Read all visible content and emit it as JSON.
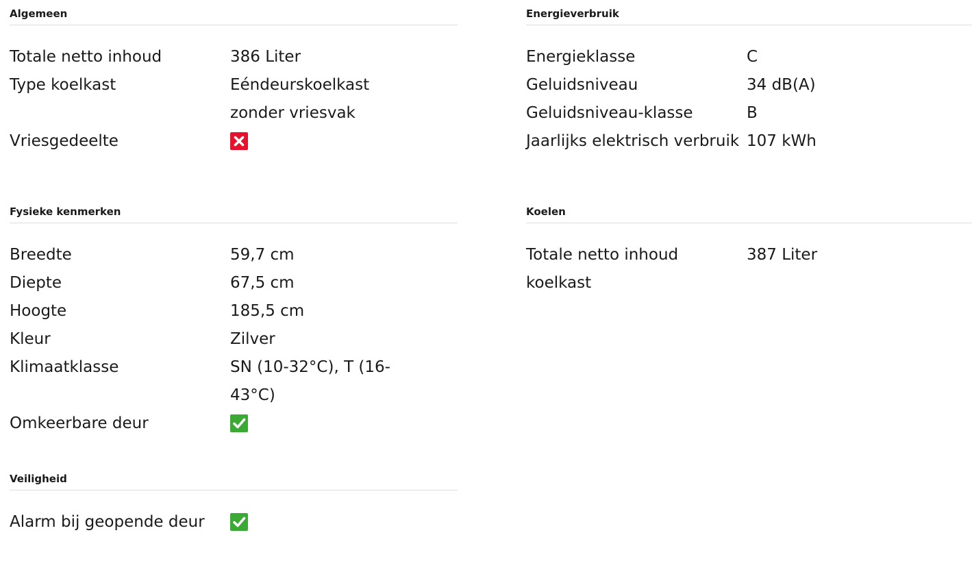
{
  "colors": {
    "no_icon_bg": "#e8112d",
    "yes_icon_bg": "#3aaa35",
    "divider": "#dddddd"
  },
  "sections": {
    "algemeen": {
      "title": "Algemeen",
      "rows": [
        {
          "label": "Totale netto inhoud",
          "value": "386 Liter"
        },
        {
          "label": "Type koelkast",
          "value": "Eéndeurskoelkast zonder vriesvak"
        },
        {
          "label": "Vriesgedeelte",
          "icon": "cross-icon",
          "state": "no"
        }
      ]
    },
    "energieverbruik": {
      "title": "Energieverbruik",
      "rows": [
        {
          "label": "Energieklasse",
          "value": "C"
        },
        {
          "label": "Geluidsniveau",
          "value": "34 dB(A)"
        },
        {
          "label": "Geluidsniveau-klasse",
          "value": "B"
        },
        {
          "label": "Jaarlijks elektrisch verbruik",
          "value": "107 kWh"
        }
      ]
    },
    "fysieke": {
      "title": "Fysieke kenmerken",
      "rows": [
        {
          "label": "Breedte",
          "value": "59,7 cm"
        },
        {
          "label": "Diepte",
          "value": "67,5 cm"
        },
        {
          "label": "Hoogte",
          "value": "185,5 cm"
        },
        {
          "label": "Kleur",
          "value": "Zilver"
        },
        {
          "label": "Klimaatklasse",
          "value": "SN (10-32°C), T (16-43°C)"
        },
        {
          "label": "Omkeerbare deur",
          "icon": "checkmark-icon",
          "state": "yes"
        }
      ]
    },
    "koelen": {
      "title": "Koelen",
      "rows": [
        {
          "label": "Totale netto inhoud koelkast",
          "value": "387 Liter"
        }
      ]
    },
    "veiligheid": {
      "title": "Veiligheid",
      "rows": [
        {
          "label": "Alarm bij geopende deur",
          "icon": "checkmark-icon",
          "state": "yes"
        }
      ]
    }
  }
}
